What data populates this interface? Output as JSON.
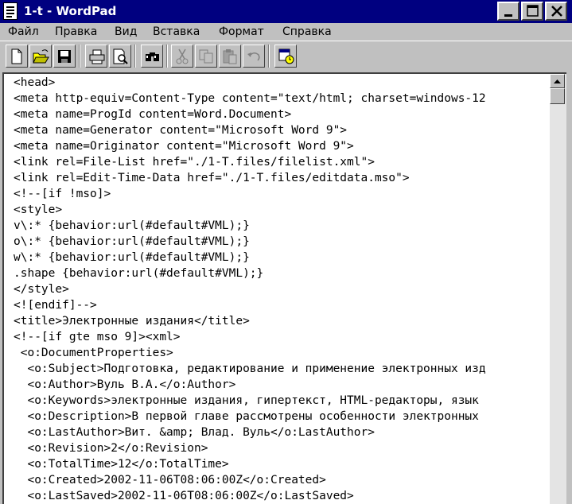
{
  "window": {
    "title": "1-t - WordPad",
    "icons": [
      "wordpad-doc-icon",
      "minimize-icon",
      "maximize-icon",
      "close-icon"
    ]
  },
  "menu": [
    {
      "label": "Файл"
    },
    {
      "label": "Правка"
    },
    {
      "label": "Вид"
    },
    {
      "label": "Вставка"
    },
    {
      "label": "Формат"
    },
    {
      "label": "Справка"
    }
  ],
  "toolbar": {
    "buttons": [
      "new-document-icon",
      "open-folder-icon",
      "save-disk-icon",
      "print-icon",
      "print-preview-icon",
      "find-binoculars-icon",
      "cut-scissors-icon",
      "copy-icon",
      "paste-icon",
      "undo-icon",
      "insert-datetime-icon"
    ],
    "disabled": [
      "cut-scissors-icon",
      "copy-icon",
      "paste-icon",
      "undo-icon"
    ]
  },
  "document": {
    "lines": [
      "<head>",
      "<meta http-equiv=Content-Type content=\"text/html; charset=windows-12",
      "<meta name=ProgId content=Word.Document>",
      "<meta name=Generator content=\"Microsoft Word 9\">",
      "<meta name=Originator content=\"Microsoft Word 9\">",
      "<link rel=File-List href=\"./1-T.files/filelist.xml\">",
      "<link rel=Edit-Time-Data href=\"./1-T.files/editdata.mso\">",
      "<!--[if !mso]>",
      "<style>",
      "v\\:* {behavior:url(#default#VML);}",
      "o\\:* {behavior:url(#default#VML);}",
      "w\\:* {behavior:url(#default#VML);}",
      ".shape {behavior:url(#default#VML);}",
      "</style>",
      "<![endif]-->",
      "<title>Электронные издания</title>",
      "<!--[if gte mso 9]><xml>",
      " <o:DocumentProperties>",
      "  <o:Subject>Подготовка, редактирование и применение электронных изд",
      "  <o:Author>Вуль В.А.</o:Author>",
      "  <o:Keywords>электронные издания, гипертекст, HTML-редакторы, язык",
      "  <o:Description>В первой главе рассмотрены особенности электронных",
      "  <o:LastAuthor>Вит. &amp; Влад. Вуль</o:LastAuthor>",
      "  <o:Revision>2</o:Revision>",
      "  <o:TotalTime>12</o:TotalTime>",
      "  <o:Created>2002-11-06T08:06:00Z</o:Created>",
      "  <o:LastSaved>2002-11-06T08:06:00Z</o:LastSaved>"
    ]
  },
  "scrollbar": {
    "icons": [
      "scroll-up-arrow-icon"
    ],
    "position": 0
  }
}
